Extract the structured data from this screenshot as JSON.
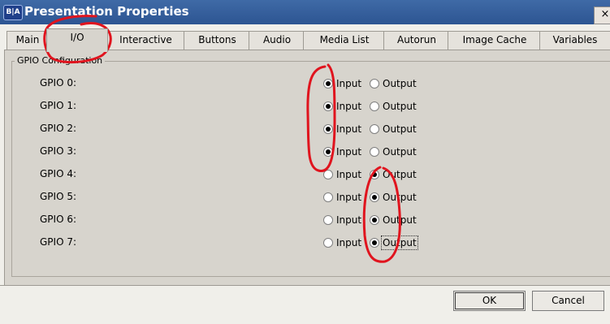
{
  "window": {
    "title": "Presentation Properties",
    "app_icon_text": "B|A",
    "close_glyph": "×"
  },
  "tabs": [
    {
      "label": "Main",
      "active": false
    },
    {
      "label": "I/O",
      "active": true
    },
    {
      "label": "Interactive",
      "active": false
    },
    {
      "label": "Buttons",
      "active": false
    },
    {
      "label": "Audio",
      "active": false
    },
    {
      "label": "Media List",
      "active": false
    },
    {
      "label": "Autorun",
      "active": false
    },
    {
      "label": "Image Cache",
      "active": false
    },
    {
      "label": "Variables",
      "active": false
    }
  ],
  "gpio": {
    "group_title": "GPIO Configuration",
    "input_label": "Input",
    "output_label": "Output",
    "rows": [
      {
        "label": "GPIO 0:",
        "selected": "input"
      },
      {
        "label": "GPIO 1:",
        "selected": "input"
      },
      {
        "label": "GPIO 2:",
        "selected": "input"
      },
      {
        "label": "GPIO 3:",
        "selected": "input"
      },
      {
        "label": "GPIO 4:",
        "selected": "output"
      },
      {
        "label": "GPIO 5:",
        "selected": "output"
      },
      {
        "label": "GPIO 6:",
        "selected": "output"
      },
      {
        "label": "GPIO 7:",
        "selected": "output"
      }
    ]
  },
  "buttons": {
    "ok": "OK",
    "cancel": "Cancel"
  },
  "colors": {
    "titlebar": "#3f6aa6",
    "annotation": "#e0141e"
  }
}
